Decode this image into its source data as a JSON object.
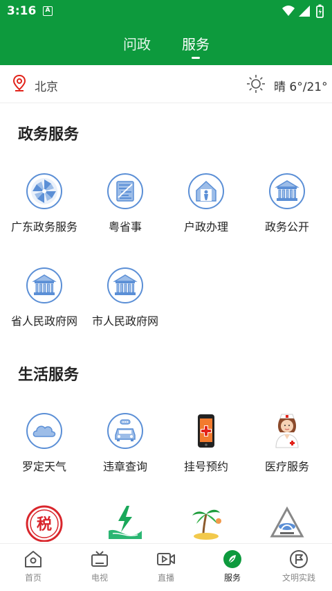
{
  "status_bar": {
    "time": "3:16",
    "notification_icon": "A"
  },
  "top_tabs": [
    {
      "label": "问政"
    },
    {
      "label": "服务",
      "active": true
    }
  ],
  "location": {
    "city": "北京",
    "weather": "晴 6°/21°"
  },
  "sections": {
    "gov": {
      "title": "政务服务",
      "items": [
        {
          "label": "广东政务服务",
          "icon": "pinwheel-icon"
        },
        {
          "label": "粤省事",
          "icon": "yue-logo-icon"
        },
        {
          "label": "户政办理",
          "icon": "house-person-icon"
        },
        {
          "label": "政务公开",
          "icon": "government-building-icon"
        },
        {
          "label": "省人民政府网",
          "icon": "government-building-icon"
        },
        {
          "label": "市人民政府网",
          "icon": "government-building-icon"
        }
      ]
    },
    "life": {
      "title": "生活服务",
      "items": [
        {
          "label": "罗定天气",
          "icon": "cloud-icon"
        },
        {
          "label": "违章查询",
          "icon": "car-icon"
        },
        {
          "label": "挂号预约",
          "icon": "phone-medical-icon"
        },
        {
          "label": "医疗服务",
          "icon": "nurse-icon"
        },
        {
          "label": "",
          "icon": "tax-seal-icon",
          "logo_text": "税"
        },
        {
          "label": "",
          "icon": "electricity-icon"
        },
        {
          "label": "",
          "icon": "palm-island-icon"
        },
        {
          "label": "",
          "icon": "road-triangle-icon"
        }
      ]
    }
  },
  "bottom_nav": [
    {
      "label": "首页",
      "icon": "home-icon"
    },
    {
      "label": "电视",
      "icon": "tv-icon"
    },
    {
      "label": "直播",
      "icon": "video-play-icon"
    },
    {
      "label": "服务",
      "icon": "compass-icon",
      "active": true
    },
    {
      "label": "文明实践",
      "icon": "flag-circle-icon"
    }
  ],
  "colors": {
    "brand_green": "#0d9a3d",
    "icon_blue": "#5b8fd6",
    "icon_fill": "#9dbde8",
    "text": "#222222",
    "inactive": "#888888"
  }
}
